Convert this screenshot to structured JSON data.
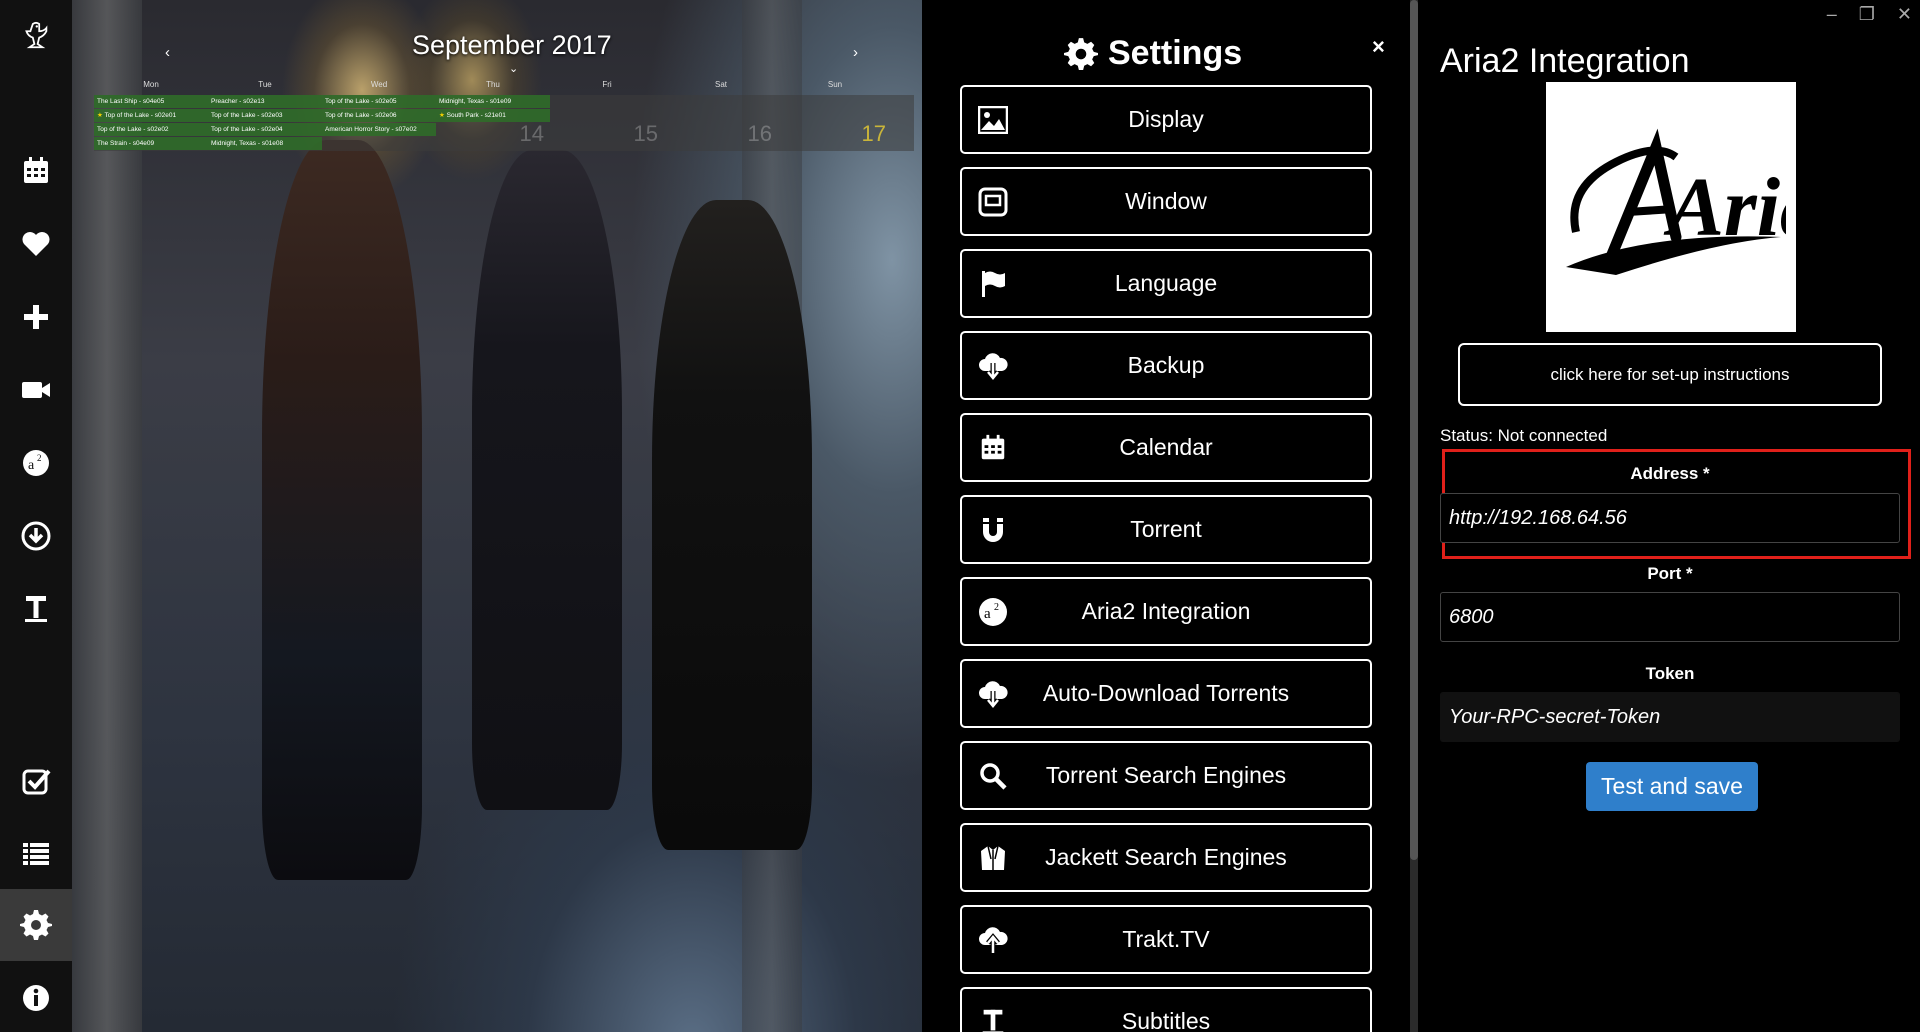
{
  "rail": {
    "items": [
      {
        "name": "logo-bird-icon"
      },
      {
        "name": "calendar-icon"
      },
      {
        "name": "heart-icon"
      },
      {
        "name": "plus-icon"
      },
      {
        "name": "video-camera-icon"
      },
      {
        "name": "aria2-icon"
      },
      {
        "name": "download-icon"
      },
      {
        "name": "text-icon"
      },
      {
        "name": "check-square-icon"
      },
      {
        "name": "list-icon"
      },
      {
        "name": "gear-icon"
      },
      {
        "name": "info-icon"
      }
    ],
    "active": "gear-icon"
  },
  "calendar": {
    "title": "September 2017",
    "prev": "‹",
    "next": "›",
    "chevron": "⌄",
    "days": [
      "Mon",
      "Tue",
      "Wed",
      "Thu",
      "Fri",
      "Sat",
      "Sun"
    ],
    "events": {
      "mon": [
        "The Last Ship - s04e05",
        "Top of the Lake - s02e01",
        "Top of the Lake - s02e02",
        "The Strain - s04e09"
      ],
      "tue": [
        "Preacher - s02e13",
        "Top of the Lake - s02e03",
        "Top of the Lake - s02e04",
        "Midnight, Texas - s01e08"
      ],
      "wed": [
        "Top of the Lake - s02e05",
        "Top of the Lake - s02e06",
        "American Horror Story - s07e02"
      ],
      "thu": [
        "Midnight, Texas - s01e09",
        "South Park - s21e01"
      ]
    },
    "starred": [
      "Top of the Lake - s02e01",
      "South Park - s21e01"
    ],
    "numbers": {
      "thu": "14",
      "fri": "15",
      "sat": "16",
      "sun": "17"
    },
    "today_color": "#c9b53a"
  },
  "settings": {
    "title": "Settings",
    "close": "×",
    "items": [
      {
        "label": "Display",
        "icon": "image-icon"
      },
      {
        "label": "Window",
        "icon": "window-icon"
      },
      {
        "label": "Language",
        "icon": "flag-icon"
      },
      {
        "label": "Backup",
        "icon": "cloud-download-icon"
      },
      {
        "label": "Calendar",
        "icon": "calendar-icon"
      },
      {
        "label": "Torrent",
        "icon": "magnet-icon"
      },
      {
        "label": "Aria2 Integration",
        "icon": "aria2-icon"
      },
      {
        "label": "Auto-Download Torrents",
        "icon": "cloud-download-icon"
      },
      {
        "label": "Torrent Search Engines",
        "icon": "search-icon"
      },
      {
        "label": "Jackett Search Engines",
        "icon": "jacket-icon"
      },
      {
        "label": "Trakt.TV",
        "icon": "cloud-upload-icon"
      },
      {
        "label": "Subtitles",
        "icon": "text-icon"
      }
    ]
  },
  "window_controls": {
    "minimize": "–",
    "maximize": "❐",
    "close": "✕"
  },
  "panel": {
    "title": "Aria2 Integration",
    "logo_text": "Aria",
    "setup_button": "click here for set-up instructions",
    "status": "Status: Not connected",
    "address": {
      "label": "Address *",
      "value": "http://192.168.64.56"
    },
    "port": {
      "label": "Port *",
      "value": "6800"
    },
    "token": {
      "label": "Token",
      "value": "Your-RPC-secret-Token"
    },
    "test_save": "Test and save",
    "accent_color": "#2f7fcb",
    "highlight_color": "#e0201a"
  }
}
